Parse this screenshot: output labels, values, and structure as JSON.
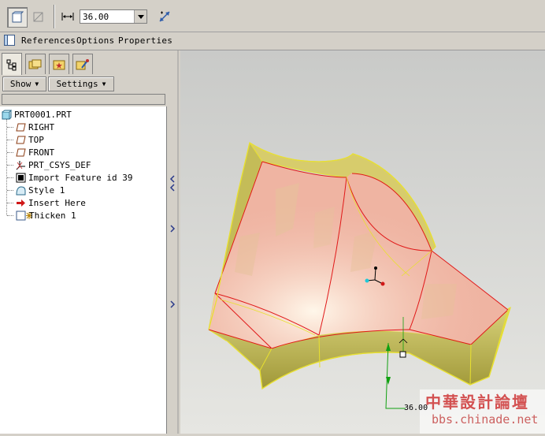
{
  "toolbar": {
    "thickness_value": "36.00",
    "buttons": [
      {
        "name": "solid-thicken-icon",
        "pressed": true
      },
      {
        "name": "remove-material-icon",
        "pressed": false
      },
      {
        "name": "thickness-dimension-icon",
        "pressed": false
      },
      {
        "name": "flip-direction-icon",
        "pressed": false
      }
    ]
  },
  "tabs": {
    "references": "References",
    "options": "Options",
    "properties": "Properties"
  },
  "navigator": {
    "show_label": "Show",
    "settings_label": "Settings",
    "tabs": [
      "model-tree-icon",
      "folder-browser-icon",
      "favorites-icon",
      "connections-icon"
    ]
  },
  "tree": {
    "root": "PRT0001.PRT",
    "items": [
      {
        "label": "RIGHT",
        "icon": "datum-plane-icon"
      },
      {
        "label": "TOP",
        "icon": "datum-plane-icon"
      },
      {
        "label": "FRONT",
        "icon": "datum-plane-icon"
      },
      {
        "label": "PRT_CSYS_DEF",
        "icon": "coordinate-system-icon"
      },
      {
        "label": "Import Feature id 39",
        "icon": "import-feature-icon"
      },
      {
        "label": "Style 1",
        "icon": "style-feature-icon"
      },
      {
        "label": "Insert Here",
        "icon": "insert-here-arrow-icon"
      },
      {
        "label": "Thicken 1",
        "icon": "thicken-feature-icon"
      }
    ]
  },
  "viewport": {
    "dimension_label": "36.00",
    "watermark_cn": "中華設計論壇",
    "watermark_url": "bbs.chinade.net"
  }
}
